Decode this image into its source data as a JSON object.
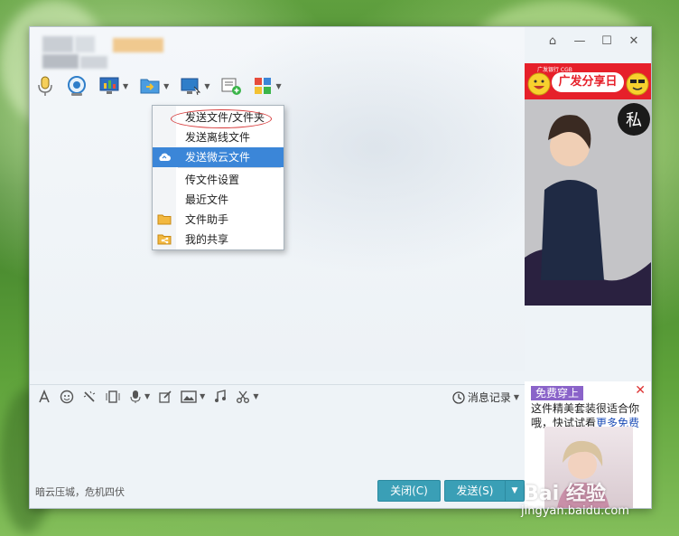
{
  "window": {
    "controls": {
      "shield": "⌂",
      "minimize": "—",
      "maximize": "☐",
      "close": "✕"
    }
  },
  "toolbar": {
    "items": [
      {
        "name": "microphone-icon"
      },
      {
        "name": "camera-icon"
      },
      {
        "name": "screen-share-icon"
      },
      {
        "name": "folder-send-icon"
      },
      {
        "name": "remote-desktop-icon"
      },
      {
        "name": "send-message-icon"
      },
      {
        "name": "apps-icon"
      }
    ]
  },
  "file_menu": {
    "items": [
      {
        "label": "发送文件/文件夹",
        "icon": "",
        "selected": false,
        "circled": true
      },
      {
        "label": "发送离线文件",
        "icon": "",
        "selected": false
      },
      {
        "label": "发送微云文件",
        "icon": "cloud-icon",
        "selected": true
      },
      {
        "label": "传文件设置",
        "icon": "",
        "selected": false
      },
      {
        "label": "最近文件",
        "icon": "",
        "selected": false
      },
      {
        "label": "文件助手",
        "icon": "folder-icon",
        "selected": false
      },
      {
        "label": "我的共享",
        "icon": "share-folder-icon",
        "selected": false
      }
    ]
  },
  "ad_top": {
    "small_text": "广发银行 CGB",
    "pill": "广发分享日"
  },
  "format_bar": {
    "history_label": "消息记录"
  },
  "status_text": "暗云压城，危机四伏",
  "buttons": {
    "close_label": "关闭(C)",
    "send_label": "发送(S)",
    "send_dropdown": "▼"
  },
  "ad_bottom": {
    "tag": "免费穿上",
    "close": "✕",
    "text_line1": "这件精美套装很适合你",
    "text_line2": "哦，快试试看",
    "link": "更多免费"
  },
  "watermark": {
    "brand": "Bai 经验",
    "url": "jingyan.baidu.com"
  },
  "colors": {
    "accent": "#3a9fb6",
    "menu_selected": "#3b86d8",
    "ad_red": "#e6202a",
    "ad_tag": "#8a63c9"
  }
}
